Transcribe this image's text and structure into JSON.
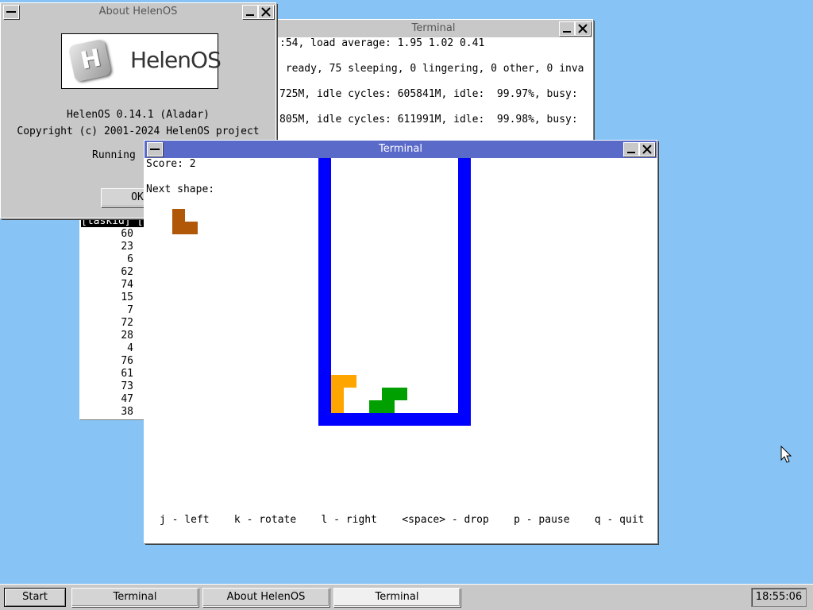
{
  "terminal_top": {
    "title": "Terminal",
    "lines": [
      ":54, load average: 1.95 1.02 0.41",
      " ready, 75 sleeping, 0 lingering, 0 other, 0 inva",
      "725M, idle cycles: 605841M, idle:  99.97%, busy:",
      "805M, idle cycles: 611991M, idle:  99.98%, busy:"
    ],
    "table_header": "[taskid] [",
    "task_ids": [
      "60",
      "23",
      "6",
      "62",
      "74",
      "15",
      "7",
      "72",
      "28",
      "4",
      "76",
      "61",
      "73",
      "47",
      "38"
    ]
  },
  "about": {
    "title": "About HelenOS",
    "logo_text": "HelenOS",
    "logo_letter": "H",
    "version": "HelenOS 0.14.1 (Aladar)",
    "copyright": "Copyright (c) 2001-2024 HelenOS project",
    "running": "Running",
    "ok_label": "OK"
  },
  "tetris": {
    "title": "Terminal",
    "score": "Score: 2",
    "next_shape": "Next shape:",
    "help": "j - left    k - rotate    l - right    <space> - drop    p - pause    q - quit",
    "colors": {
      "well": "#0000ff",
      "next_piece": "#b05808",
      "orange_piece": "#ffa500",
      "green_piece": "#00a000"
    }
  },
  "taskbar": {
    "start": "Start",
    "buttons": [
      "Terminal",
      "About HelenOS",
      "Terminal"
    ],
    "clock": "18:55:06"
  }
}
